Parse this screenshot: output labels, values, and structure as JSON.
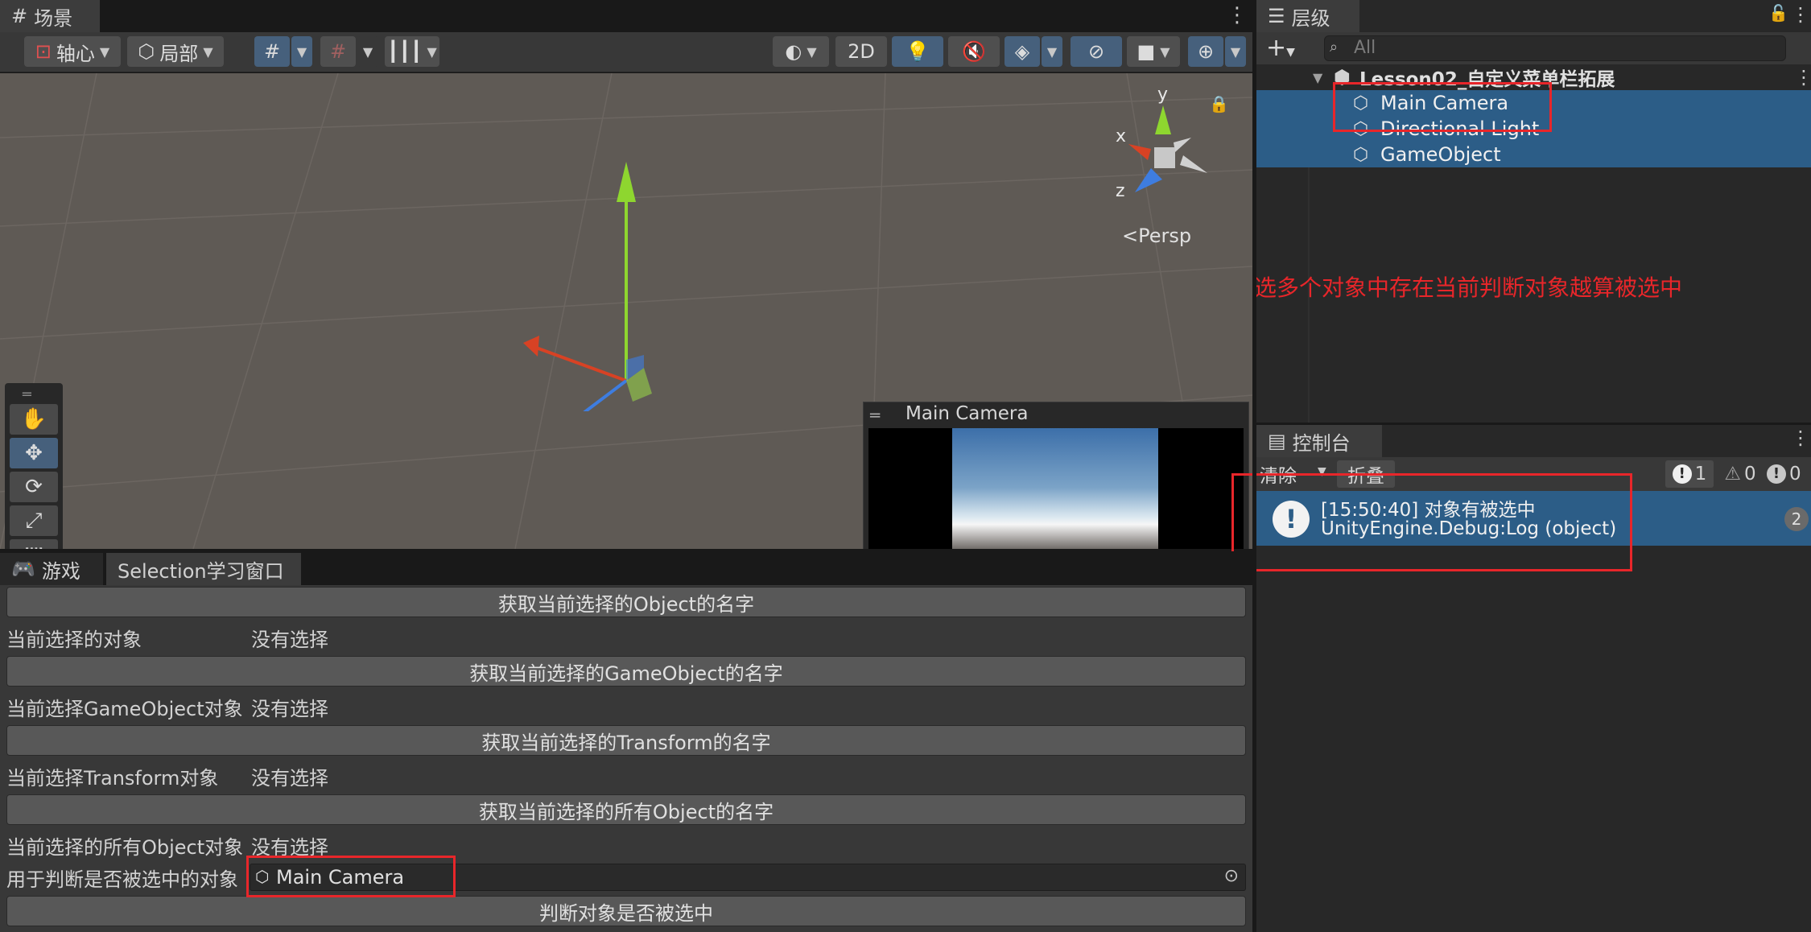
{
  "scene_panel": {
    "tab_label": "场景",
    "toolbar": {
      "pivot_label": "轴心",
      "local_label": "局部",
      "mode_2d_label": "2D"
    },
    "gizmo": {
      "axis_x": "x",
      "axis_y": "y",
      "axis_z": "z",
      "projection_label": "Persp"
    },
    "camera_preview_title": "Main Camera"
  },
  "hierarchy_panel": {
    "tab_label": "层级",
    "search_placeholder": "All",
    "scene_name": "Lesson02_自定义菜单栏拓展",
    "items": [
      {
        "label": "Main Camera"
      },
      {
        "label": "Directional Light"
      },
      {
        "label": "GameObject"
      }
    ]
  },
  "annotation_text": "选多个对象中存在当前判断对象越算被选中",
  "console_panel": {
    "tab_label": "控制台",
    "clear_label": "清除",
    "collapse_label": "折叠",
    "info_count": "1",
    "warning_count": "0",
    "error_count": "0",
    "log_entry": {
      "line1": "[15:50:40] 对象有被选中",
      "line2": "UnityEngine.Debug:Log (object)",
      "count": "2"
    }
  },
  "bottom_panel": {
    "tabs": [
      {
        "label": "游戏"
      },
      {
        "label": "Selection学习窗口"
      }
    ],
    "buttons": [
      "获取当前选择的Object的名字",
      "获取当前选择的GameObject的名字",
      "获取当前选择的Transform的名字",
      "获取当前选择的所有Object的名字",
      "判断对象是否被选中"
    ],
    "fields": [
      {
        "label": "当前选择的对象",
        "value": "没有选择"
      },
      {
        "label": "当前选择GameObject对象",
        "value": "没有选择"
      },
      {
        "label": "当前选择Transform对象",
        "value": "没有选择"
      },
      {
        "label": "当前选择的所有Object对象",
        "value": "没有选择"
      }
    ],
    "object_field": {
      "label": "用于判断是否被选中的对象",
      "value": "Main Camera"
    }
  },
  "colors": {
    "selection": "#2c5d87",
    "annotation_red": "#e8262a",
    "toggle_on": "#46607c"
  }
}
